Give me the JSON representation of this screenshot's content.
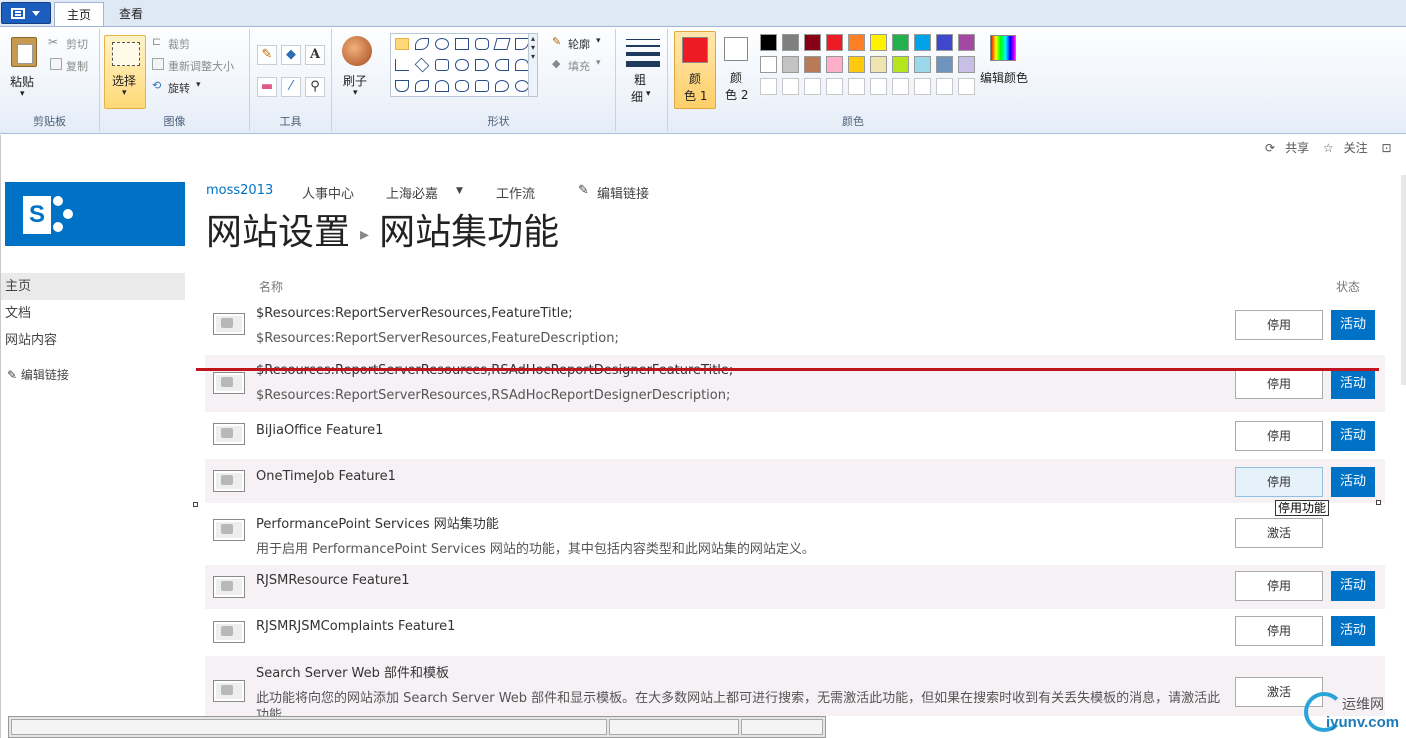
{
  "paint": {
    "tabs": [
      "主页",
      "查看"
    ],
    "clipboard": {
      "paste": "粘贴",
      "cut": "剪切",
      "copy": "复制",
      "group": "剪贴板"
    },
    "image": {
      "select": "选择",
      "crop": "裁剪",
      "resize": "重新调整大小",
      "rotate": "旋转",
      "group": "图像"
    },
    "tools": {
      "group": "工具"
    },
    "brushes": {
      "label": "刷子"
    },
    "shapes": {
      "outline": "轮廓",
      "fill": "填充",
      "group": "形状"
    },
    "size": {
      "label1": "粗",
      "label2": "细"
    },
    "colors": {
      "color1_l1": "颜",
      "color1_l2": "色 1",
      "color2_l1": "颜",
      "color2_l2": "色 2",
      "edit": "编辑颜色",
      "group": "颜色",
      "color1": "#ed1c24",
      "color2": "#ffffff",
      "row1": [
        "#000000",
        "#7f7f7f",
        "#880015",
        "#ed1c24",
        "#ff7f27",
        "#fff200",
        "#22b14c",
        "#00a2e8",
        "#3f48cc",
        "#a349a4"
      ],
      "row2": [
        "#ffffff",
        "#c3c3c3",
        "#b97a57",
        "#ffaec9",
        "#ffc90e",
        "#efe4b0",
        "#b5e61d",
        "#99d9ea",
        "#7092be",
        "#c8bfe7"
      ]
    }
  },
  "sharepoint": {
    "suite": {
      "share": "共享",
      "follow": "关注"
    },
    "logo_letter": "S",
    "topnav": [
      "moss2013",
      "人事中心",
      "上海必嘉",
      "工作流"
    ],
    "edit_links": "编辑链接",
    "title": {
      "part1": "网站设置",
      "part2": "网站集功能"
    },
    "quicklaunch": [
      "主页",
      "文档",
      "网站内容"
    ],
    "headers": {
      "name": "名称",
      "status": "状态"
    },
    "deactivate": "停用",
    "activate": "激活",
    "active": "活动",
    "tooltip": "停用功能",
    "features": [
      {
        "title": "$Resources:ReportServerResources,FeatureTitle;",
        "desc": "$Resources:ReportServerResources,FeatureDescription;"
      },
      {
        "title": "$Resources:ReportServerResources,RSAdHocReportDesignerFeatureTitle;",
        "desc": "$Resources:ReportServerResources,RSAdHocReportDesignerDescription;"
      },
      {
        "title": "BiJiaOffice Feature1",
        "desc": ""
      },
      {
        "title": "OneTimeJob Feature1",
        "desc": ""
      },
      {
        "title": "PerformancePoint Services 网站集功能",
        "desc": "用于启用 PerformancePoint Services 网站的功能，其中包括内容类型和此网站集的网站定义。"
      },
      {
        "title": "RJSMResource Feature1",
        "desc": ""
      },
      {
        "title": "RJSMRJSMComplaints Feature1",
        "desc": ""
      },
      {
        "title": "Search Server Web 部件和模板",
        "desc": "此功能将向您的网站添加 Search Server Web 部件和显示模板。在大多数网站上都可进行搜索，无需激活此功能，但如果在搜索时收到有关丢失模板的消息，请激活此",
        "desc2": "功能。"
      }
    ]
  },
  "watermark": {
    "cn": "运维网",
    "en": "iyunv.com"
  }
}
